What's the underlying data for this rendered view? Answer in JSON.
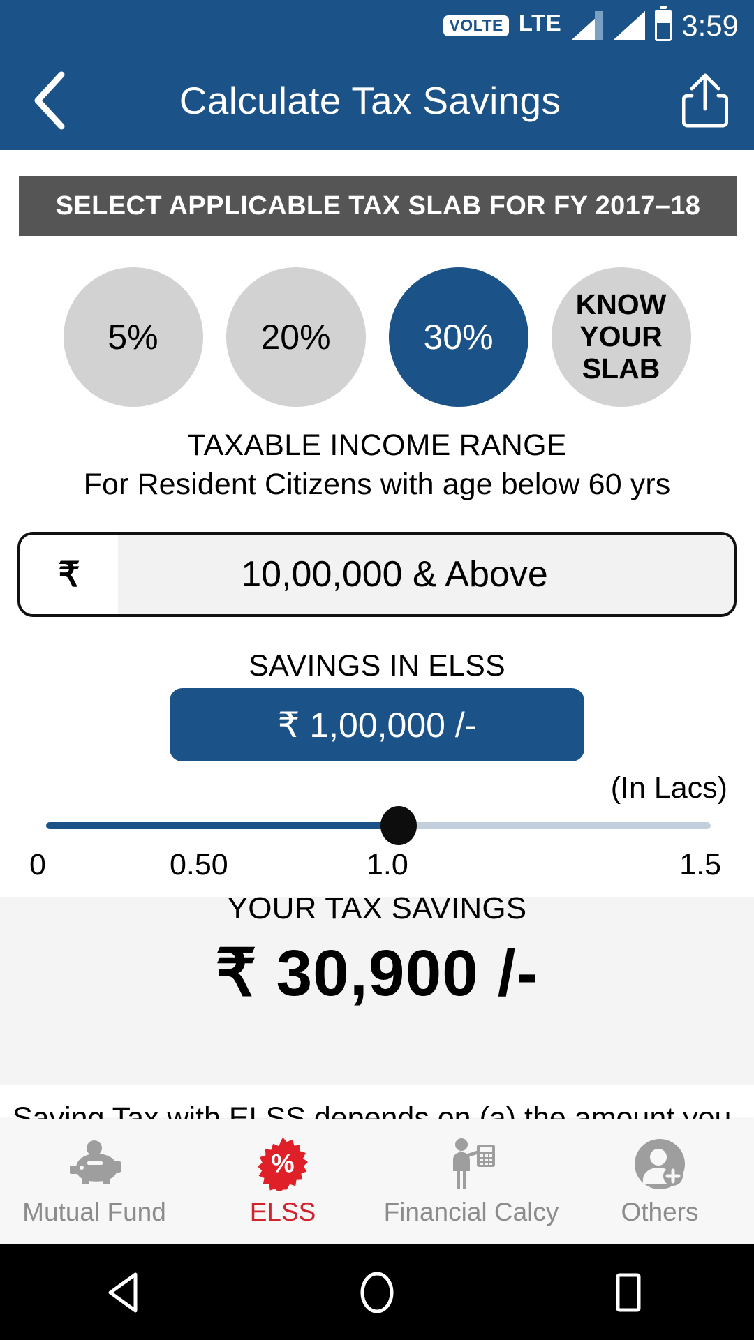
{
  "status_bar": {
    "volte_badge": "VOLTE",
    "network": "LTE",
    "time": "3:59",
    "icons": [
      "volte-badge",
      "lte-label",
      "signal-bars-1",
      "signal-bars-2",
      "battery-icon"
    ]
  },
  "app_bar": {
    "title": "Calculate Tax Savings",
    "back_icon": "back-chevron-icon",
    "share_icon": "share-icon",
    "background_color": "#1B5288"
  },
  "slab_section": {
    "banner": "SELECT APPLICABLE TAX SLAB FOR FY 2017–18",
    "banner_color": "#555555",
    "options": [
      {
        "label": "5%",
        "selected": false
      },
      {
        "label": "20%",
        "selected": false
      },
      {
        "label": "30%",
        "selected": true
      },
      {
        "label": "KNOW YOUR SLAB",
        "selected": false,
        "multiline": true
      }
    ],
    "selected_color": "#1B5288",
    "unselected_color": "#d2d2d2"
  },
  "income_range": {
    "label": "TAXABLE INCOME RANGE",
    "sublabel": "For Resident Citizens with age below 60 yrs",
    "currency_symbol": "₹",
    "value": "10,00,000 & Above"
  },
  "elss_savings": {
    "label": "SAVINGS IN ELSS",
    "amount": "₹ 1,00,000 /-",
    "pill_color": "#1B5288"
  },
  "slider": {
    "unit_label": "(In Lacs)",
    "value": 1.0,
    "min": 0,
    "max": 1.5,
    "ticks": [
      "0",
      "0.50",
      "1.0",
      "1.5"
    ],
    "fill_color": "#1B5288",
    "rail_color": "#c2d0de"
  },
  "tax_savings": {
    "label": "YOUR TAX SAVINGS",
    "amount": "₹ 30,900 /-",
    "background_color": "#f4f4f4"
  },
  "disclaimer": {
    "text": "Saving Tax with ELSS depends on (a) the amount you"
  },
  "tab_bar": {
    "active_color": "#d0232b",
    "inactive_color": "#8c8c8c",
    "tabs": [
      {
        "label": "Mutual Fund",
        "icon": "piggy-bank-icon",
        "active": false
      },
      {
        "label": "ELSS",
        "icon": "percent-badge-icon",
        "active": true
      },
      {
        "label": "Financial Calcy",
        "icon": "person-calculator-icon",
        "active": false
      },
      {
        "label": "Others",
        "icon": "person-add-icon",
        "active": false
      }
    ]
  },
  "android_nav": {
    "buttons": [
      {
        "icon": "android-back-icon"
      },
      {
        "icon": "android-home-icon"
      },
      {
        "icon": "android-recents-icon"
      }
    ]
  }
}
